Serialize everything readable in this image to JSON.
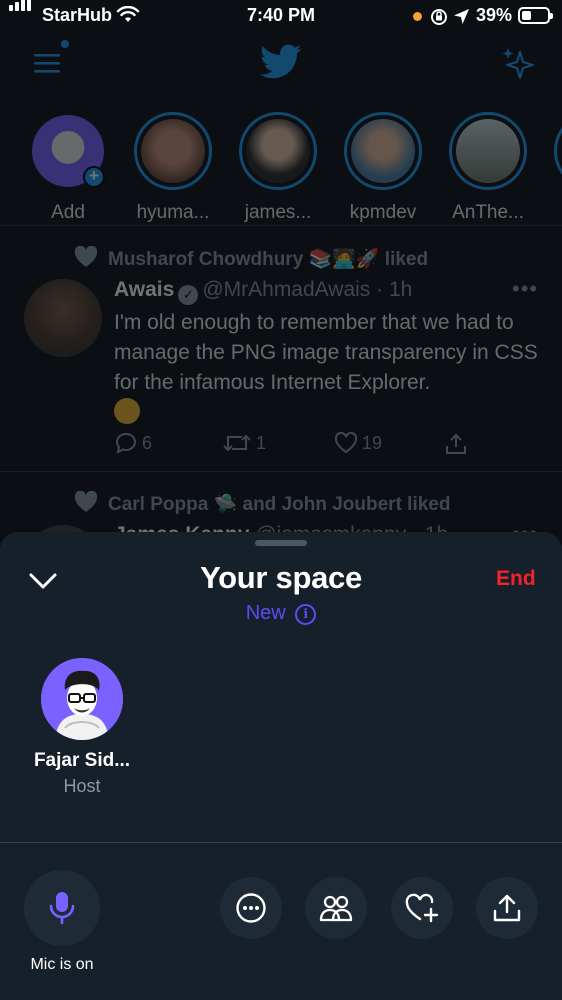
{
  "status_bar": {
    "carrier": "StarHub",
    "time": "7:40 PM",
    "battery_pct": "39%",
    "battery_level": 0.39,
    "signal_icon": "signal-bars-icon",
    "wifi_icon": "wifi-icon",
    "location_icon": "location-arrow-icon",
    "rotation_lock_icon": "rotation-lock-icon"
  },
  "header": {
    "menu_icon": "hamburger-menu-icon",
    "logo_icon": "twitter-bird-icon",
    "sparkle_icon": "sparkle-icon",
    "accent": "#1d9bf0"
  },
  "fleets": [
    {
      "name": "Add"
    },
    {
      "name": "hyuma..."
    },
    {
      "name": "james..."
    },
    {
      "name": "kpmdev"
    },
    {
      "name": "AnThe..."
    }
  ],
  "tweets": [
    {
      "liked_by": "Musharof Chowdhury 📚🧑‍💻🚀 liked",
      "author": "Awais",
      "handle": "@MrAhmadAwais · 1h",
      "body": "I'm old enough to remember that we had to manage the PNG image transparency in CSS for the infamous Internet Explorer.",
      "replies": "6",
      "retweets": "1",
      "likes": "19"
    },
    {
      "liked_by": "Carl Poppa 🛸 and John Joubert liked",
      "author": "James Kenny",
      "handle": "@jamesmkenny · 1h"
    }
  ],
  "space": {
    "title": "Your space",
    "end_label": "End",
    "new_label": "New",
    "info_glyph": "i",
    "end_color": "#f4212e",
    "new_color": "#5b4cf5",
    "host": {
      "name": "Fajar Sid...",
      "role": "Host",
      "avatar_color": "#7b61ff"
    },
    "controls": {
      "mic_label": "Mic is on",
      "mic_icon": "microphone-icon",
      "more_icon": "more-options-icon",
      "people_icon": "people-icon",
      "heart_icon": "heart-plus-icon",
      "share_icon": "share-icon"
    }
  }
}
